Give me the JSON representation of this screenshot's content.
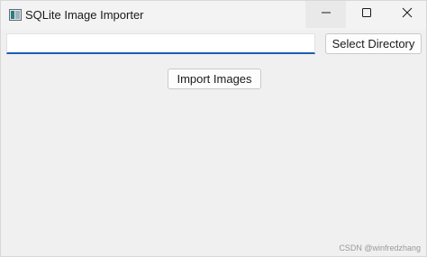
{
  "window": {
    "title": "SQLite Image Importer",
    "app_icon": "app-window-icon",
    "controls": {
      "minimize_icon": "minimize-icon",
      "maximize_icon": "maximize-icon",
      "close_icon": "close-icon"
    }
  },
  "form": {
    "directory_value": "",
    "select_directory_label": "Select Directory",
    "import_images_label": "Import Images"
  },
  "watermark": "CSDN @winfredzhang",
  "colors": {
    "background": "#f0f0f0",
    "input_focus_underline": "#1a5fb4"
  }
}
